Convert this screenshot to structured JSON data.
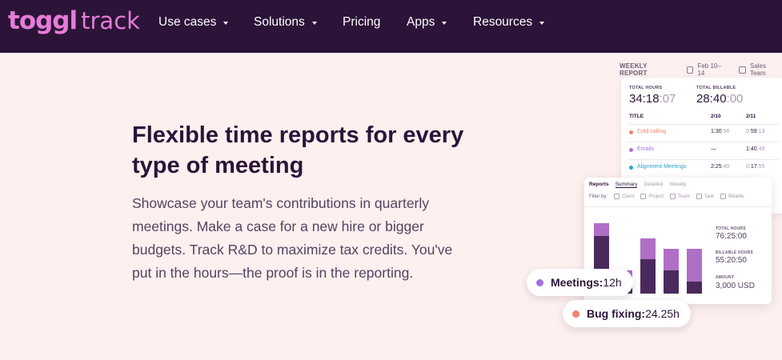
{
  "nav": {
    "logo_bold": "toggl",
    "logo_light": "track",
    "items": [
      {
        "label": "Use cases"
      },
      {
        "label": "Solutions"
      },
      {
        "label": "Pricing"
      },
      {
        "label": "Apps"
      },
      {
        "label": "Resources"
      }
    ]
  },
  "hero": {
    "headline_line1": "Flexible time reports for every",
    "headline_line2": "type of meeting",
    "body_line1": "Showcase your team's contributions in quarterly",
    "body_line2": "meetings. Make a case for a new hire or bigger",
    "body_line3": "budgets. Track R&D to maximize tax credits. You've",
    "body_line4": "put in the hours—the proof is in the reporting."
  },
  "weekly_report": {
    "title": "WEEKLY REPORT",
    "date_range": "Feb 10–14",
    "team": "Sales Team",
    "total_hours_label": "TOTAL HOURS",
    "total_hours_main": "34:18",
    "total_hours_dim": ":07",
    "total_billable_label": "TOTAL BILLABLE",
    "total_billable_main": "28:40",
    "total_billable_dim": ":00",
    "col_title": "TITLE",
    "col_d1": "2/10",
    "col_d2": "2/11",
    "rows": [
      {
        "name": "Cold calling",
        "color": "#f0826f",
        "d1_main": "1:30",
        "d1_dim": ":56",
        "d2_main": "0:",
        "d2_bold": "59",
        "d2_dim": ":13"
      },
      {
        "name": "Emails",
        "color": "#a36ee3",
        "d1_main": "—",
        "d1_dim": "",
        "d2_main": "1:40",
        "d2_bold": "",
        "d2_dim": ":48"
      },
      {
        "name": "Alignment Meetings",
        "color": "#2aa3c9",
        "d1_main": "2:25",
        "d1_dim": ":40",
        "d2_main": "0:",
        "d2_bold": "17",
        "d2_dim": ":55"
      }
    ]
  },
  "reports_card": {
    "tab_main": "Reports",
    "tab_summary": "Summary",
    "tab_detailed": "Detailed",
    "tab_weekly": "Weekly",
    "filter_by": "Filter by:",
    "filters": [
      "Client",
      "Project",
      "Team",
      "Task",
      "Billable"
    ],
    "bars": [
      {
        "top_share": 0.18,
        "total": 1.0
      },
      {
        "top_share": 0.45,
        "total": 0.33
      },
      {
        "top_share": 0.37,
        "total": 0.78
      },
      {
        "top_share": 0.49,
        "total": 0.64
      },
      {
        "top_share": 0.74,
        "total": 0.64
      }
    ],
    "stats": [
      {
        "label": "TOTAL HOURS",
        "value": "76:25:00"
      },
      {
        "label": "BILLABLE HOURS",
        "value": "55:20:50"
      },
      {
        "label": "AMOUNT",
        "value": "3,000 USD"
      }
    ]
  },
  "pills": {
    "meetings_label": "Meetings:",
    "meetings_value": " 12h",
    "meetings_color": "#a36ee3",
    "bug_label": "Bug fixing:",
    "bug_value": " 24.25h",
    "bug_color": "#f0826f"
  },
  "colors": {
    "nav_bg": "#2c1338",
    "page_bg": "#fdf0ef",
    "brand_pink": "#e57cd8"
  }
}
